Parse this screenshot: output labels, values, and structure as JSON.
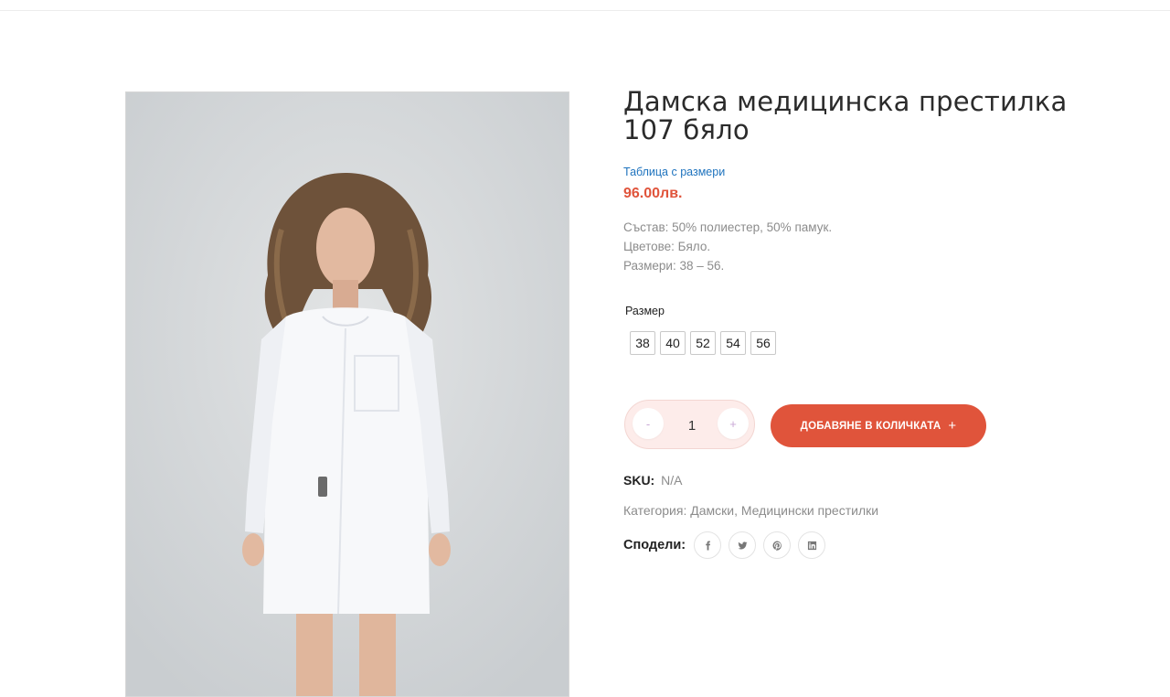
{
  "product": {
    "title_line1": "Дамска медицинска престилка",
    "title_line2": "107 бяло",
    "size_table_link": "Таблица с размери",
    "price": "96.00лв.",
    "description": [
      "Състав: 50% полиестер, 50% памук.",
      "Цветове: Бяло.",
      "Размери: 38 – 56."
    ],
    "size_label": "Размер",
    "sizes": [
      "38",
      "40",
      "52",
      "54",
      "56"
    ],
    "quantity": {
      "value": "1",
      "minus": "-",
      "plus": "+"
    },
    "add_to_cart_label": "ДОБАВЯНЕ В КОЛИЧКАТА",
    "add_to_cart_icon": "+",
    "sku_label": "SKU:",
    "sku_value": "N/A",
    "category_label": "Категория:",
    "categories": [
      "Дамски",
      "Медицински престилки"
    ],
    "category_separator": ",",
    "share_label": "Сподели:",
    "share_icons": [
      "facebook-icon",
      "twitter-icon",
      "pinterest-icon",
      "linkedin-icon"
    ]
  },
  "colors": {
    "accent": "#e0543b",
    "link": "#1e73be",
    "muted_text": "#8c8c8c",
    "qty_bg": "#fdecea"
  }
}
